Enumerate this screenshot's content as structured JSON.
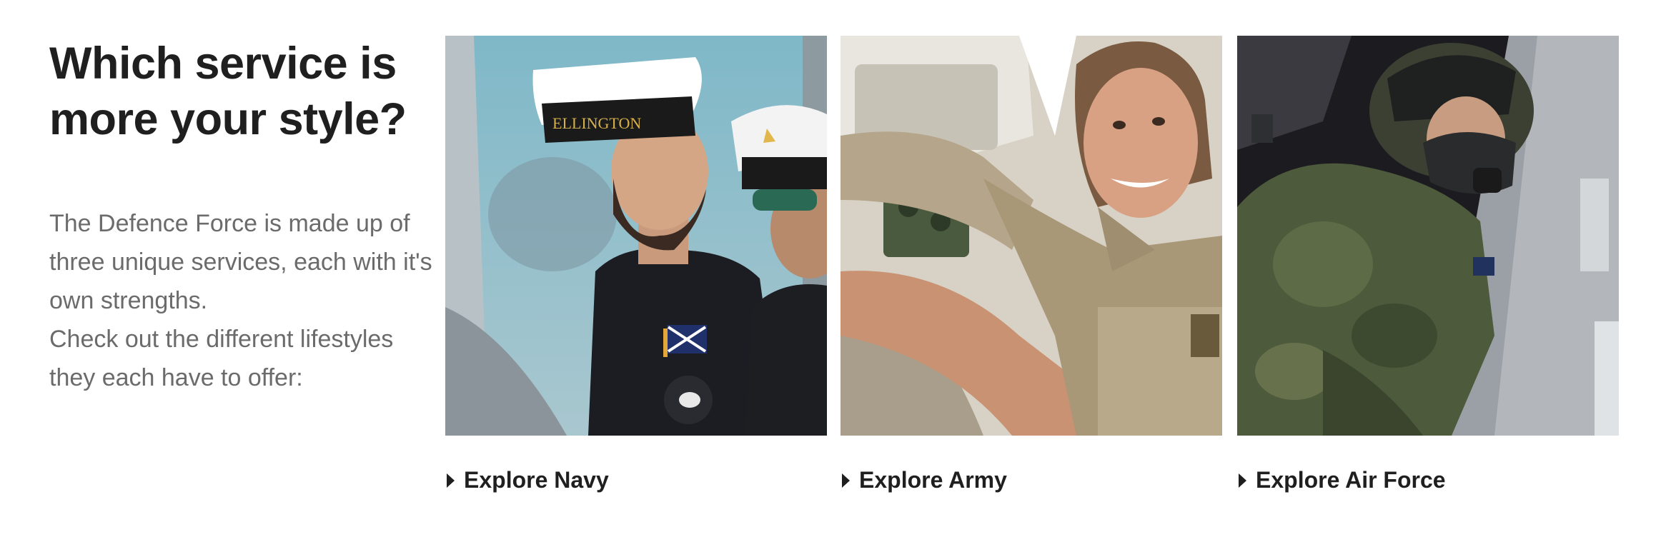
{
  "intro": {
    "heading": "Which service is more your style?",
    "description_lines": [
      "The Defence Force is made up of three unique services, each with it's own strengths.",
      "Check out the different lifestyles they each have to offer:"
    ]
  },
  "services": [
    {
      "id": "navy",
      "link_label": "Explore Navy",
      "photo": "navy-sailor-photo",
      "cap_band_text": "ELLINGTON"
    },
    {
      "id": "army",
      "link_label": "Explore Army",
      "photo": "army-soldier-photo"
    },
    {
      "id": "airforce",
      "link_label": "Explore Air Force",
      "photo": "air-force-pilot-photo"
    }
  ],
  "icons": {
    "link_marker": "caret-right-icon"
  },
  "colors": {
    "heading": "#1f1f1f",
    "body_text": "#6b6b6b",
    "background": "#ffffff"
  }
}
